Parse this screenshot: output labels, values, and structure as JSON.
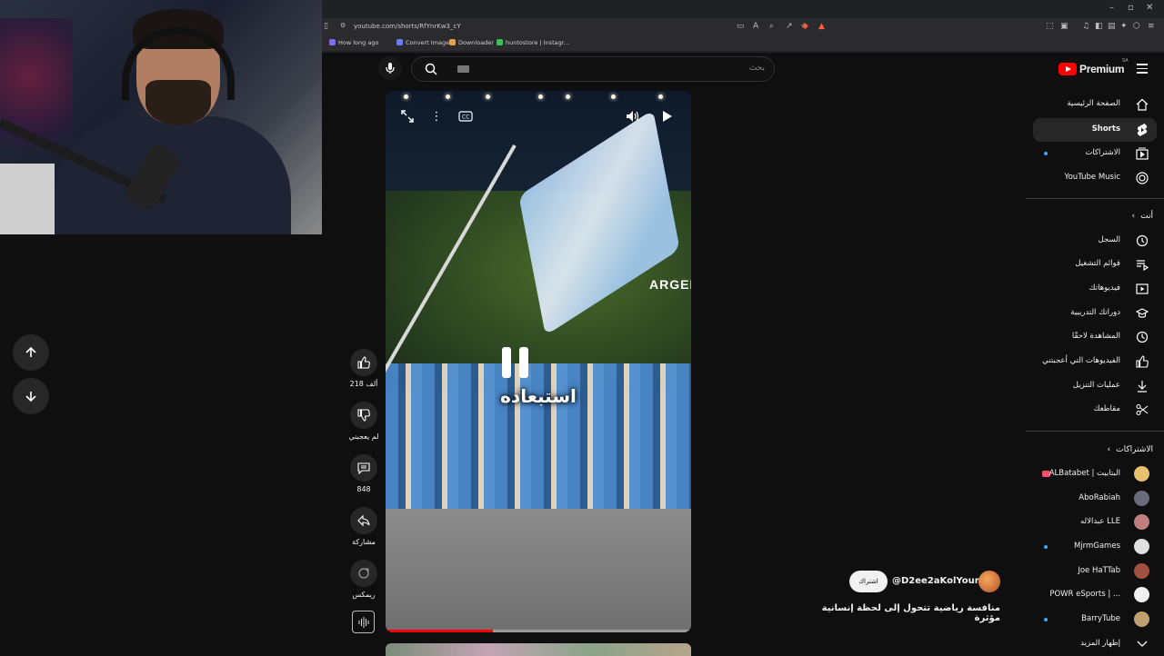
{
  "browser": {
    "url": "youtube.com/shorts/RfYnrKw3_cY",
    "bookmarks": [
      {
        "label": "How long ago",
        "color": "#7b6cf0"
      },
      {
        "label": "Convert Image",
        "color": "#6c7cf0"
      },
      {
        "label": "Downloader",
        "color": "#e0a050"
      },
      {
        "label": "huntostore | Instagr...",
        "color": "#3bbf5a"
      }
    ]
  },
  "header": {
    "logo_text": "Premium",
    "region": "SA",
    "search_placeholder": "بحث"
  },
  "video": {
    "subtitle": "استبعاده",
    "sign_text": "ARGENTIN",
    "progress": 0.35
  },
  "actions": {
    "like_count": "218 ألف",
    "dislike_label": "لم يعجبني",
    "comment_count": "848",
    "share_label": "مشاركة",
    "remix_label": "ريمكس"
  },
  "channel": {
    "handle": "@D2ee2aKolYoum",
    "subscribe_label": "اشتراك",
    "video_title": "منافسة رياضية تتحول إلى لحظة إنسانية مؤثرة"
  },
  "sidebar": {
    "main": [
      {
        "label": "الصفحة الرئيسية",
        "icon": "home-icon",
        "active": false,
        "dot": false
      },
      {
        "label": "Shorts",
        "icon": "shorts-icon",
        "active": true,
        "dot": false
      },
      {
        "label": "الاشتراكات",
        "icon": "subscriptions-icon",
        "active": false,
        "dot": true
      },
      {
        "label": "YouTube Music",
        "icon": "music-icon",
        "active": false,
        "dot": false
      }
    ],
    "you_heading": "أنت",
    "you": [
      {
        "label": "السجل",
        "icon": "history-icon"
      },
      {
        "label": "قوائم التشغيل",
        "icon": "playlists-icon"
      },
      {
        "label": "فيديوهاتك",
        "icon": "your-videos-icon"
      },
      {
        "label": "دوراتك التدريبية",
        "icon": "courses-icon"
      },
      {
        "label": "المشاهدة لاحقًا",
        "icon": "watch-later-icon"
      },
      {
        "label": "الفيديوهات التي أعجبتني",
        "icon": "liked-icon"
      },
      {
        "label": "عمليات التنزيل",
        "icon": "downloads-icon"
      },
      {
        "label": "مقاطعك",
        "icon": "clips-icon"
      }
    ],
    "subs_heading": "الاشتراكات",
    "subscriptions": [
      {
        "label": "ALBatabet | البتابيت",
        "color": "#e8c070",
        "live": true,
        "dot": false
      },
      {
        "label": "AboRabiah",
        "color": "#6a6a7a",
        "live": false,
        "dot": false
      },
      {
        "label": "عبدالاله LLE",
        "color": "#c08080",
        "live": false,
        "dot": false
      },
      {
        "label": "MjrmGames",
        "color": "#e0e0e0",
        "live": false,
        "dot": true
      },
      {
        "label": "Joe HaTTab",
        "color": "#a05040",
        "live": false,
        "dot": false
      },
      {
        "label": "POWR eSports | ...",
        "color": "#f0f0f0",
        "live": false,
        "dot": false
      },
      {
        "label": "BarryTube",
        "color": "#c0a070",
        "live": false,
        "dot": true
      }
    ],
    "show_more": "إظهار المزيد"
  }
}
